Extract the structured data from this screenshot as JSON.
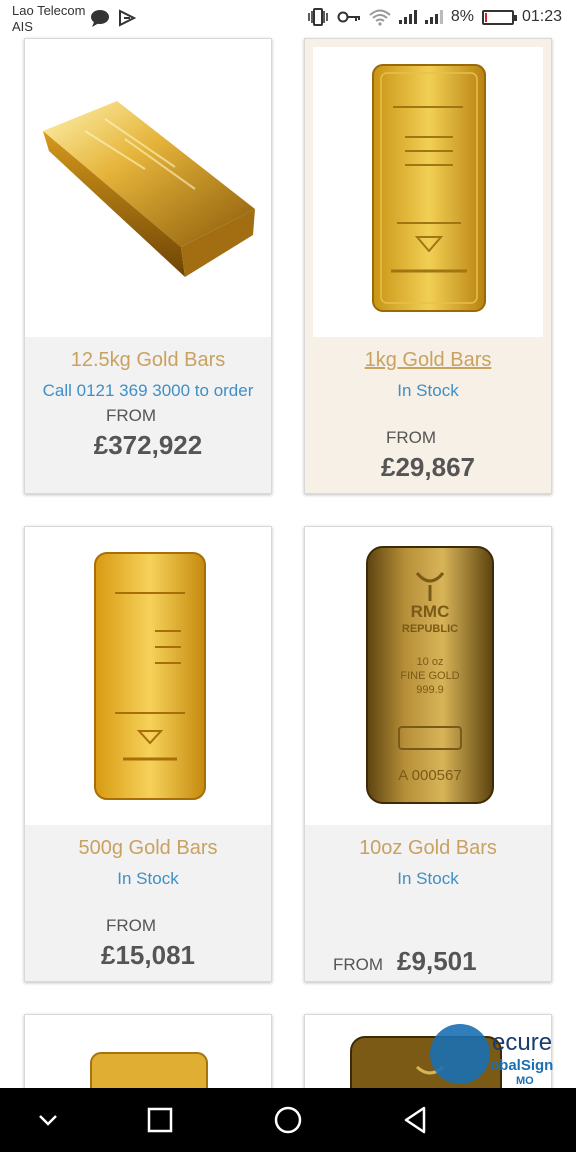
{
  "status_bar": {
    "carrier_line1": "Lao Telecom",
    "carrier_line2": "AIS",
    "battery_percent": "8%",
    "battery_level": 0.08,
    "time": "01:23"
  },
  "products": [
    {
      "title": "12.5kg Gold Bars",
      "availability": "Call 0121 369 3000 to order",
      "from_label": "FROM",
      "price": "£372,922",
      "highlighted": false
    },
    {
      "title": "1kg Gold Bars",
      "availability": "In Stock",
      "from_label": "FROM",
      "price": "£29,867",
      "highlighted": true
    },
    {
      "title": "500g Gold Bars",
      "availability": "In Stock",
      "from_label": "FROM",
      "price": "£15,081",
      "highlighted": false
    },
    {
      "title": "10oz Gold Bars",
      "availability": "In Stock",
      "from_label": "FROM",
      "price": "£9,501",
      "highlighted": false
    }
  ],
  "bar_engravings": {
    "oz10_brand_1": "RMC",
    "oz10_brand_2": "REPUBLIC",
    "oz10_weight_1": "10 oz",
    "oz10_weight_2": "FINE GOLD",
    "oz10_weight_3": "999.9",
    "oz10_serial": "A 000567"
  },
  "security_badge": {
    "line1": "ecure",
    "line2": "obalSign",
    "line3": "MO"
  },
  "colors": {
    "title_gold": "#c9a160",
    "stock_blue": "#3f8fc6",
    "price_gray": "#555555",
    "highlight_bg": "#f7f0e6",
    "battery_red": "#e02020"
  },
  "icons": [
    "chat-bubble-icon",
    "cast-icon",
    "vibrate-icon",
    "key-icon",
    "wifi-icon",
    "signal-icon",
    "battery-icon",
    "back-chevron-icon",
    "recents-square-icon",
    "home-circle-icon",
    "back-triangle-icon"
  ]
}
